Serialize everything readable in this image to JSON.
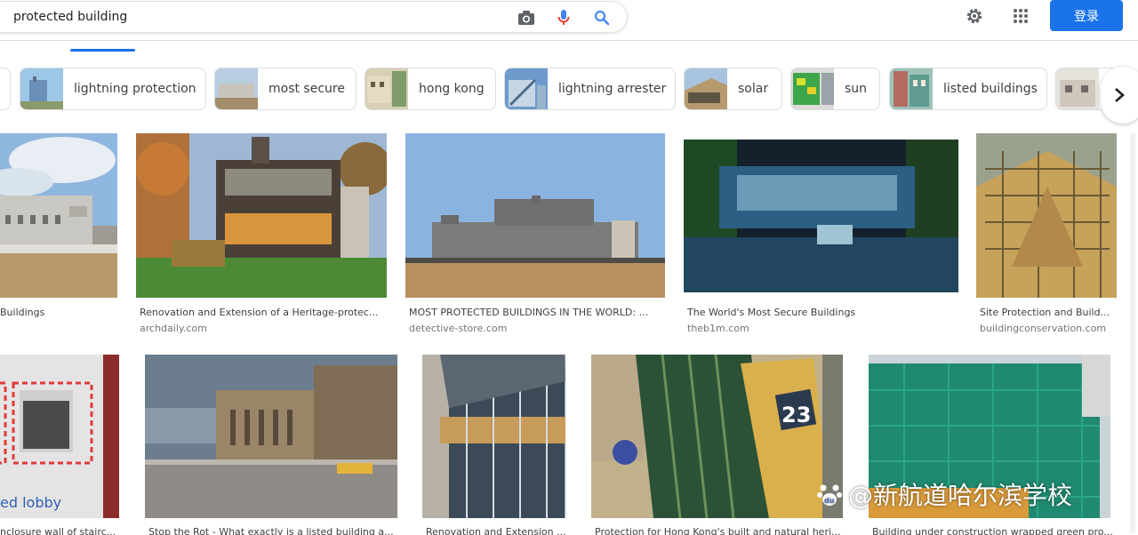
{
  "search": {
    "query": "protected building"
  },
  "header": {
    "signin_label": "登录"
  },
  "chips": [
    {
      "label": ""
    },
    {
      "label": "lightning protection"
    },
    {
      "label": "most secure"
    },
    {
      "label": "hong kong"
    },
    {
      "label": "lightning arrester"
    },
    {
      "label": "solar"
    },
    {
      "label": "sun"
    },
    {
      "label": "listed buildings"
    },
    {
      "label": ""
    }
  ],
  "results": [
    {
      "title": "Buildings",
      "source": ""
    },
    {
      "title": "Renovation and Extension of a Heritage-protec...",
      "source": "archdaily.com"
    },
    {
      "title": "MOST PROTECTED BUILDINGS IN THE WORLD: ...",
      "source": "detective-store.com"
    },
    {
      "title": "The World's Most Secure Buildings",
      "source": "theb1m.com"
    },
    {
      "title": "Site Protection and Build...",
      "source": "buildingconservation.com"
    },
    {
      "title": "nclosure wall of stairc...",
      "source": ""
    },
    {
      "title": "Stop the Rot - What exactly is a listed building a...",
      "source": ""
    },
    {
      "title": "Renovation and Extension ...",
      "source": ""
    },
    {
      "title": "Protection for Hong Kong's built and natural heri...",
      "source": ""
    },
    {
      "title": "Building under construction wrapped green pro...",
      "source": ""
    }
  ],
  "image_text": {
    "lobby_caption": "ed lobby",
    "house_number": "23"
  },
  "watermark": {
    "text": "@新航道哈尔滨学校",
    "logo": "du"
  },
  "colors": {
    "accent": "#1a73e8",
    "mic_red": "#ea4335",
    "mic_blue": "#4285f4"
  }
}
